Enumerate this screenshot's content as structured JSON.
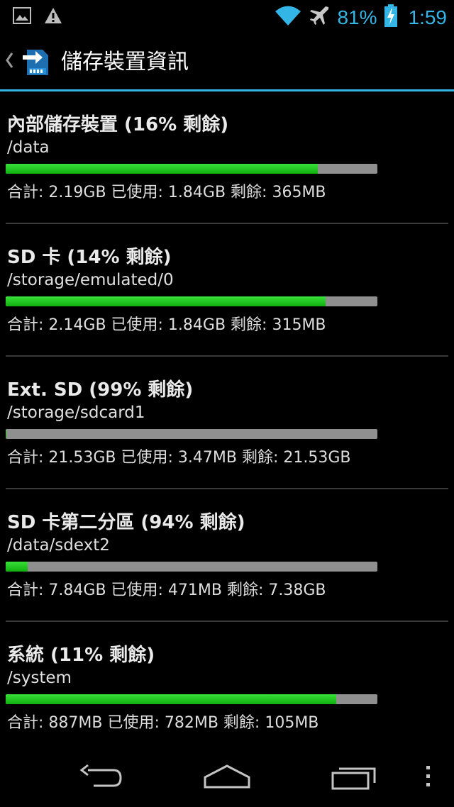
{
  "status_bar": {
    "left_icons": [
      "image-icon",
      "warning-icon"
    ],
    "right_icons": [
      "wifi-icon",
      "airplane-icon",
      "battery-charging-icon"
    ],
    "battery_percent": "81%",
    "time": "1:59"
  },
  "action_bar": {
    "title": "儲存裝置資訊",
    "app_icon": "sd-card-transfer-icon"
  },
  "storages": [
    {
      "name": "內部儲存裝置 (16% 剩餘)",
      "path": "/data",
      "used_fraction": 0.84,
      "detail": "合計: 2.19GB 已使用: 1.84GB 剩餘: 365MB"
    },
    {
      "name": "SD 卡 (14% 剩餘)",
      "path": "/storage/emulated/0",
      "used_fraction": 0.86,
      "detail": "合計: 2.14GB 已使用: 1.84GB 剩餘: 315MB"
    },
    {
      "name": "Ext. SD (99% 剩餘)",
      "path": "/storage/sdcard1",
      "used_fraction": 0.002,
      "detail": "合計: 21.53GB 已使用: 3.47MB 剩餘: 21.53GB"
    },
    {
      "name": "SD 卡第二分區 (94% 剩餘)",
      "path": "/data/sdext2",
      "used_fraction": 0.06,
      "detail": "合計: 7.84GB 已使用: 471MB 剩餘: 7.38GB"
    },
    {
      "name": "系統 (11% 剩餘)",
      "path": "/system",
      "used_fraction": 0.89,
      "detail": "合計: 887MB 已使用: 782MB 剩餘: 105MB"
    }
  ],
  "colors": {
    "accent": "#33b5e5",
    "bar_used": "#22c822",
    "bar_free": "#8f8f8f"
  },
  "nav_bar": {
    "buttons": [
      "back-icon",
      "home-icon",
      "recent-apps-icon",
      "overflow-menu-icon"
    ]
  }
}
